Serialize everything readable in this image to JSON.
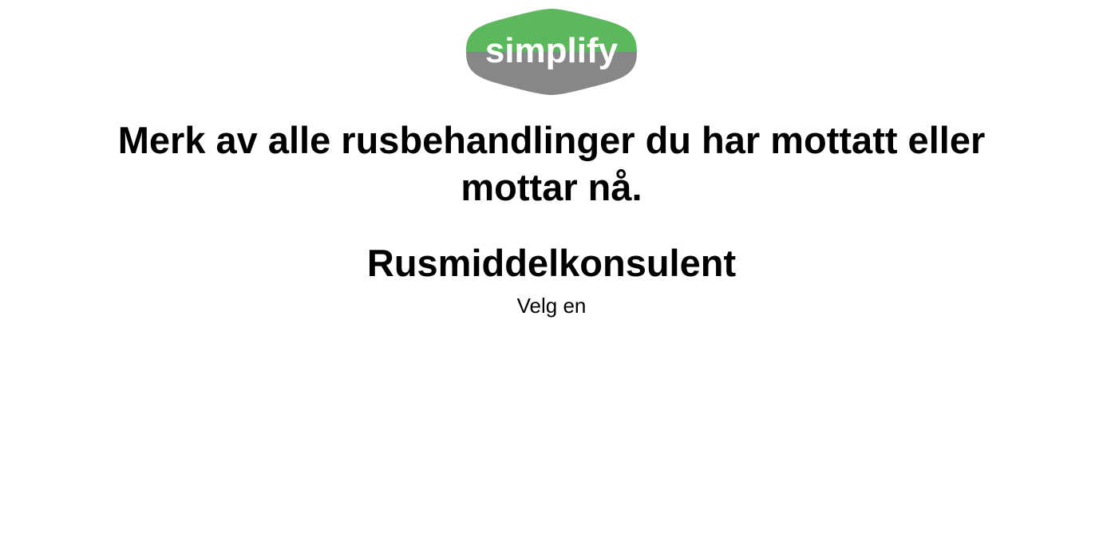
{
  "logo": {
    "text": "simplify",
    "colors": {
      "top": "#5cb85c",
      "bottom": "#858789",
      "text": "#ffffff"
    }
  },
  "question": {
    "text": "Merk av alle rusbehandlinger du har mottatt eller mottar nå."
  },
  "option": {
    "title": "Rusmiddelkonsulent",
    "hint": "Velg en"
  }
}
